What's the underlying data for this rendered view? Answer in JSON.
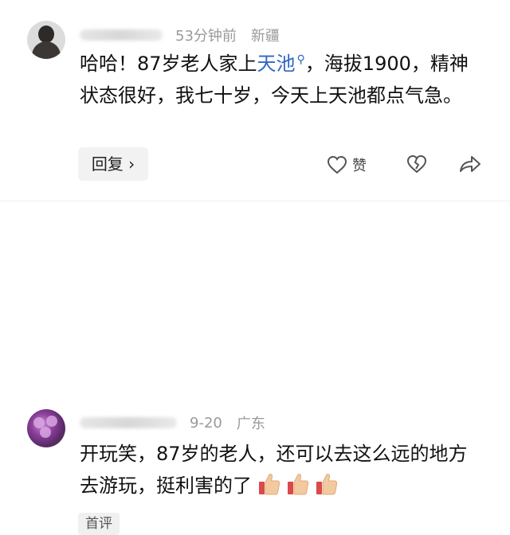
{
  "comments": [
    {
      "time": "53分钟前",
      "location": "新疆",
      "text_before": "哈哈！87岁老人家上",
      "link": "天池",
      "text_after": "，海拔1900，精神状态很好，我七十岁，今天上天池都点气急。",
      "reply_label": "回复 ›",
      "like_label": "赞",
      "icons": [
        "heart-outline-icon",
        "broken-heart-icon",
        "share-arrow-icon"
      ]
    },
    {
      "time": "9-20",
      "location": "广东",
      "text": "开玩笑，87岁的老人，还可以去这么远的地方去游玩，挺利害的了",
      "emoji": [
        "thumbs-up-emoji",
        "thumbs-up-emoji",
        "thumbs-up-emoji"
      ],
      "tag": "首评"
    }
  ],
  "colors": {
    "link": "#2f67c5",
    "meta": "#9a9a9a",
    "button_bg": "#f2f2f2"
  }
}
